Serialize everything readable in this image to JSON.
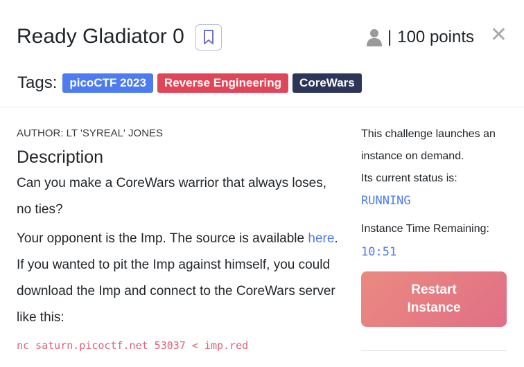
{
  "header": {
    "title": "Ready Gladiator 0",
    "points_separator": "|",
    "points": "100 points",
    "close_symbol": "✕"
  },
  "tags": {
    "label": "Tags:",
    "items": [
      "picoCTF 2023",
      "Reverse Engineering",
      "CoreWars"
    ]
  },
  "content": {
    "author": "AUTHOR: LT 'SYREAL' JONES",
    "description_heading": "Description",
    "paragraph_1": "Can you make a CoreWars warrior that always loses, no ties?",
    "paragraph_2_prefix": "Your opponent is the Imp. The source is available ",
    "paragraph_2_link": "here",
    "paragraph_2_suffix": ". If you wanted to pit the Imp against himself, you could download the Imp and connect to the CoreWars server like this:",
    "command": "nc saturn.picoctf.net 53037 < imp.red"
  },
  "instance": {
    "launch_text": "This challenge launches an instance on demand.",
    "status_label": "Its current status is:",
    "status": "RUNNING",
    "time_label": "Instance Time Remaining:",
    "time_remaining": "10:51",
    "restart_label": "Restart Instance"
  },
  "colors": {
    "accent": "#4e7cf0",
    "tag_red": "#df4759",
    "tag_dark": "#2d3658",
    "command": "#e0607a"
  },
  "icons": {
    "bookmark": "bookmark-icon",
    "user": "user-icon",
    "close": "close-icon"
  }
}
